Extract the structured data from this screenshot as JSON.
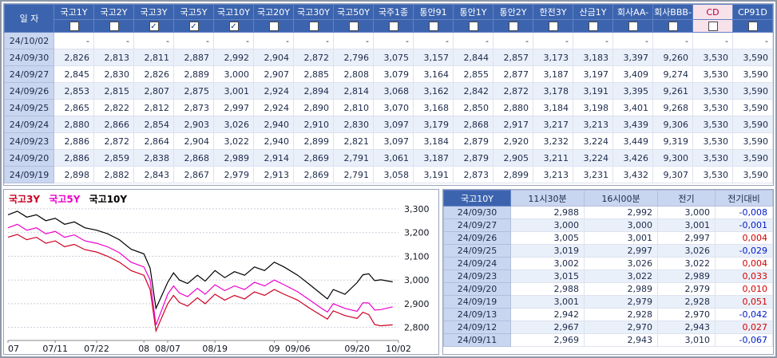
{
  "colors": {
    "header_bg": "#3c64ae",
    "header_fg": "#ffffff",
    "date_bg": "#c9d6f0",
    "alt_bg": "#eaf0fa",
    "cd_bg": "#f8e2ea",
    "cd_fg": "#b00040",
    "up": "#d40000",
    "down": "#0018c8",
    "text": "#1c2a4a"
  },
  "main_table": {
    "date_header": "일 자",
    "columns": [
      {
        "label": "국고1Y",
        "checked": false,
        "highlight": false
      },
      {
        "label": "국고2Y",
        "checked": false,
        "highlight": false
      },
      {
        "label": "국고3Y",
        "checked": true,
        "highlight": false
      },
      {
        "label": "국고5Y",
        "checked": true,
        "highlight": false
      },
      {
        "label": "국고10Y",
        "checked": true,
        "highlight": false
      },
      {
        "label": "국고20Y",
        "checked": false,
        "highlight": false
      },
      {
        "label": "국고30Y",
        "checked": false,
        "highlight": false
      },
      {
        "label": "국고50Y",
        "checked": false,
        "highlight": false
      },
      {
        "label": "국주1종",
        "checked": false,
        "highlight": false
      },
      {
        "label": "통안91",
        "checked": false,
        "highlight": false
      },
      {
        "label": "통안1Y",
        "checked": false,
        "highlight": false
      },
      {
        "label": "통안2Y",
        "checked": false,
        "highlight": false
      },
      {
        "label": "한전3Y",
        "checked": false,
        "highlight": false
      },
      {
        "label": "산금1Y",
        "checked": false,
        "highlight": false
      },
      {
        "label": "회사AA-",
        "checked": false,
        "highlight": false
      },
      {
        "label": "회사BBB-",
        "checked": false,
        "highlight": false
      },
      {
        "label": "CD",
        "checked": false,
        "highlight": true
      },
      {
        "label": "CP91D",
        "checked": false,
        "highlight": false
      }
    ],
    "rows": [
      {
        "date": "24/10/02",
        "values": [
          "-",
          "-",
          "-",
          "-",
          "-",
          "-",
          "-",
          "-",
          "-",
          "-",
          "-",
          "-",
          "-",
          "-",
          "-",
          "-",
          "-",
          "-"
        ]
      },
      {
        "date": "24/09/30",
        "values": [
          "2,826",
          "2,813",
          "2,811",
          "2,887",
          "2,992",
          "2,904",
          "2,872",
          "2,796",
          "3,075",
          "3,157",
          "2,844",
          "2,857",
          "3,173",
          "3,183",
          "3,397",
          "9,260",
          "3,530",
          "3,590"
        ]
      },
      {
        "date": "24/09/27",
        "values": [
          "2,845",
          "2,830",
          "2,826",
          "2,889",
          "3,000",
          "2,907",
          "2,885",
          "2,808",
          "3,079",
          "3,164",
          "2,855",
          "2,877",
          "3,187",
          "3,197",
          "3,409",
          "9,274",
          "3,530",
          "3,590"
        ]
      },
      {
        "date": "24/09/26",
        "values": [
          "2,853",
          "2,815",
          "2,807",
          "2,875",
          "3,001",
          "2,924",
          "2,894",
          "2,814",
          "3,068",
          "3,162",
          "2,842",
          "2,872",
          "3,178",
          "3,191",
          "3,395",
          "9,261",
          "3,530",
          "3,590"
        ]
      },
      {
        "date": "24/09/25",
        "values": [
          "2,865",
          "2,822",
          "2,812",
          "2,873",
          "2,997",
          "2,924",
          "2,890",
          "2,810",
          "3,070",
          "3,168",
          "2,850",
          "2,880",
          "3,184",
          "3,198",
          "3,401",
          "9,268",
          "3,530",
          "3,590"
        ]
      },
      {
        "date": "24/09/24",
        "values": [
          "2,880",
          "2,866",
          "2,854",
          "2,903",
          "3,026",
          "2,940",
          "2,910",
          "2,830",
          "3,097",
          "3,179",
          "2,868",
          "2,917",
          "3,217",
          "3,213",
          "3,439",
          "9,306",
          "3,530",
          "3,590"
        ]
      },
      {
        "date": "24/09/23",
        "values": [
          "2,886",
          "2,872",
          "2,864",
          "2,904",
          "3,022",
          "2,940",
          "2,899",
          "2,821",
          "3,097",
          "3,184",
          "2,879",
          "2,920",
          "3,232",
          "3,224",
          "3,449",
          "9,319",
          "3,530",
          "3,590"
        ]
      },
      {
        "date": "24/09/20",
        "values": [
          "2,886",
          "2,859",
          "2,838",
          "2,868",
          "2,989",
          "2,914",
          "2,869",
          "2,791",
          "3,061",
          "3,187",
          "2,879",
          "2,905",
          "3,211",
          "3,224",
          "3,426",
          "9,300",
          "3,530",
          "3,590"
        ]
      },
      {
        "date": "24/09/19",
        "values": [
          "2,898",
          "2,882",
          "2,843",
          "2,867",
          "2,979",
          "2,913",
          "2,869",
          "2,791",
          "3,058",
          "3,191",
          "2,873",
          "2,899",
          "3,213",
          "3,231",
          "3,432",
          "9,307",
          "3,530",
          "3,590"
        ]
      }
    ]
  },
  "chart_data": {
    "type": "line",
    "title": "",
    "legend_position": "top-left",
    "grid": true,
    "ylim": [
      2.745,
      3.33
    ],
    "y_ticks": [
      {
        "label": "3,300",
        "value": 3.3
      },
      {
        "label": "3,200",
        "value": 3.2
      },
      {
        "label": "3,100",
        "value": 3.1
      },
      {
        "label": "3,000",
        "value": 3.0
      },
      {
        "label": "2,900",
        "value": 2.9
      },
      {
        "label": "2,800",
        "value": 2.8
      }
    ],
    "x_ticks": [
      {
        "label": "07",
        "pos": 0.0
      },
      {
        "label": "07/11",
        "pos": 0.121
      },
      {
        "label": "07/22",
        "pos": 0.227
      },
      {
        "label": "08",
        "pos": 0.348
      },
      {
        "label": "08/07",
        "pos": 0.409
      },
      {
        "label": "08/19",
        "pos": 0.53
      },
      {
        "label": "09",
        "pos": 0.682
      },
      {
        "label": "09/06",
        "pos": 0.742
      },
      {
        "label": "09/20",
        "pos": 0.894
      },
      {
        "label": "10/02",
        "pos": 1.0
      }
    ],
    "x": [
      0.0,
      0.024,
      0.048,
      0.073,
      0.097,
      0.121,
      0.145,
      0.17,
      0.197,
      0.227,
      0.255,
      0.285,
      0.315,
      0.348,
      0.364,
      0.379,
      0.409,
      0.424,
      0.439,
      0.46,
      0.485,
      0.505,
      0.53,
      0.555,
      0.58,
      0.606,
      0.631,
      0.657,
      0.682,
      0.707,
      0.742,
      0.773,
      0.803,
      0.818,
      0.833,
      0.863,
      0.894,
      0.909,
      0.924,
      0.939,
      0.955,
      0.985
    ],
    "series": [
      {
        "name": "국고3Y",
        "color": "#cc0022",
        "values": [
          3.18,
          3.192,
          3.17,
          3.18,
          3.155,
          3.165,
          3.14,
          3.15,
          3.128,
          3.118,
          3.1,
          3.075,
          3.04,
          3.02,
          2.96,
          2.785,
          2.9,
          2.935,
          2.905,
          2.89,
          2.925,
          2.9,
          2.94,
          2.915,
          2.935,
          2.92,
          2.95,
          2.935,
          2.96,
          2.94,
          2.915,
          2.88,
          2.85,
          2.835,
          2.87,
          2.85,
          2.838,
          2.864,
          2.854,
          2.812,
          2.807,
          2.811
        ]
      },
      {
        "name": "국고5Y",
        "color": "#ee00cc",
        "values": [
          3.22,
          3.235,
          3.21,
          3.22,
          3.195,
          3.205,
          3.18,
          3.19,
          3.165,
          3.155,
          3.14,
          3.115,
          3.075,
          3.055,
          3.0,
          2.81,
          2.94,
          2.975,
          2.945,
          2.93,
          2.965,
          2.94,
          2.98,
          2.955,
          2.975,
          2.96,
          2.99,
          2.975,
          3.0,
          2.98,
          2.95,
          2.915,
          2.88,
          2.865,
          2.9,
          2.88,
          2.868,
          2.904,
          2.903,
          2.873,
          2.875,
          2.887
        ]
      },
      {
        "name": "국고10Y",
        "color": "#000000",
        "values": [
          3.275,
          3.29,
          3.265,
          3.275,
          3.25,
          3.26,
          3.235,
          3.245,
          3.22,
          3.21,
          3.195,
          3.17,
          3.13,
          3.11,
          3.05,
          2.88,
          2.99,
          3.03,
          3.0,
          2.985,
          3.02,
          2.995,
          3.04,
          3.01,
          3.035,
          3.02,
          3.055,
          3.04,
          3.075,
          3.055,
          3.02,
          2.98,
          2.94,
          2.92,
          2.96,
          2.94,
          2.989,
          3.022,
          3.026,
          2.997,
          3.001,
          2.992
        ]
      }
    ]
  },
  "detail_table": {
    "headers": [
      "국고10Y",
      "11시30분",
      "16시00분",
      "전기",
      "전기대비"
    ],
    "rows": [
      {
        "date": "24/09/30",
        "v1130": "2,988",
        "v1600": "2,992",
        "prev": "3,000",
        "change": "-0,008"
      },
      {
        "date": "24/09/27",
        "v1130": "3,000",
        "v1600": "3,000",
        "prev": "3,001",
        "change": "-0,001"
      },
      {
        "date": "24/09/26",
        "v1130": "3,005",
        "v1600": "3,001",
        "prev": "2,997",
        "change": "0,004"
      },
      {
        "date": "24/09/25",
        "v1130": "3,019",
        "v1600": "2,997",
        "prev": "3,026",
        "change": "-0,029"
      },
      {
        "date": "24/09/24",
        "v1130": "3,002",
        "v1600": "3,026",
        "prev": "3,022",
        "change": "0,004"
      },
      {
        "date": "24/09/23",
        "v1130": "3,015",
        "v1600": "3,022",
        "prev": "2,989",
        "change": "0,033"
      },
      {
        "date": "24/09/20",
        "v1130": "2,988",
        "v1600": "2,989",
        "prev": "2,979",
        "change": "0,010"
      },
      {
        "date": "24/09/19",
        "v1130": "3,001",
        "v1600": "2,979",
        "prev": "2,928",
        "change": "0,051"
      },
      {
        "date": "24/09/13",
        "v1130": "2,942",
        "v1600": "2,928",
        "prev": "2,970",
        "change": "-0,042"
      },
      {
        "date": "24/09/12",
        "v1130": "2,967",
        "v1600": "2,970",
        "prev": "2,943",
        "change": "0,027"
      },
      {
        "date": "24/09/11",
        "v1130": "2,969",
        "v1600": "2,943",
        "prev": "3,010",
        "change": "-0,067"
      }
    ]
  }
}
